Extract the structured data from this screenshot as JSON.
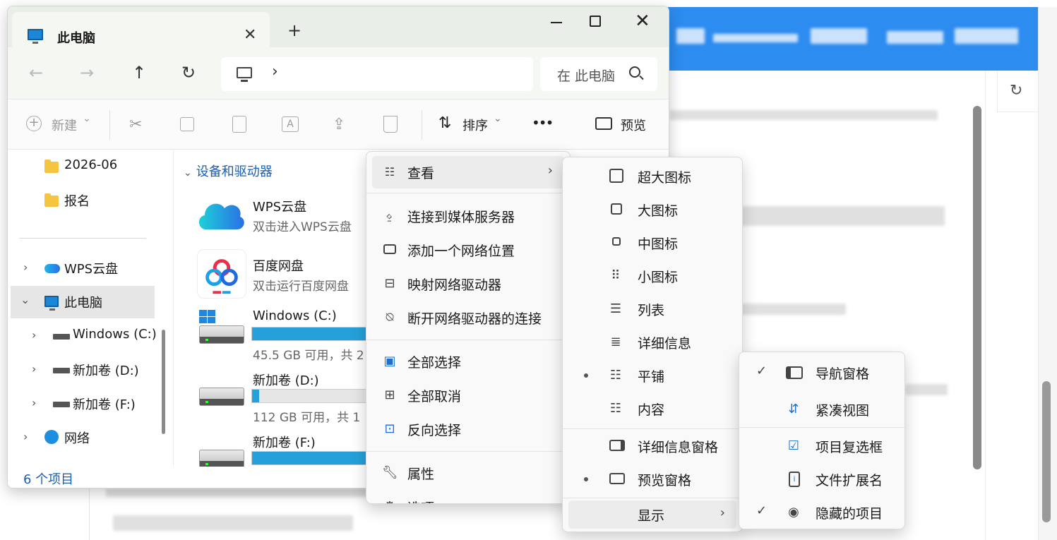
{
  "explorer": {
    "tab_title": "此电脑",
    "close_glyph": "✕",
    "new_tab_glyph": "+",
    "window_close_glyph": "✕",
    "back_glyph": "←",
    "forward_glyph": "→",
    "up_glyph": "↑",
    "refresh_glyph": "↻",
    "address_chevron": "›",
    "search_placeholder": "在 此电脑",
    "toolbar": {
      "new_label": "新建",
      "new_caret": "⌄",
      "sort_label": "排序",
      "sort_caret": "⌄",
      "more_label": "•••",
      "preview_label": "预览"
    },
    "nav": [
      {
        "label": "2026-06"
      },
      {
        "label": "报名"
      },
      {
        "label": "WPS云盘"
      },
      {
        "label": "此电脑"
      },
      {
        "label": "Windows (C:)"
      },
      {
        "label": "新加卷 (D:)"
      },
      {
        "label": "新加卷 (F:)"
      },
      {
        "label": "网络"
      }
    ],
    "group_header": "设备和驱动器",
    "items": [
      {
        "name": "WPS云盘",
        "sub": "双击进入WPS云盘"
      },
      {
        "name": "百度网盘",
        "sub": "双击运行百度网盘"
      },
      {
        "name": "Windows (C:)",
        "sub": "45.5 GB 可用，共 2",
        "fill": 0.85
      },
      {
        "name": "新加卷 (D:)",
        "sub": "112 GB 可用，共 1",
        "fill": 0.05
      },
      {
        "name": "新加卷 (F:)",
        "sub": "",
        "fill": 0.9
      }
    ],
    "status": "6 个项目"
  },
  "more_menu": {
    "items": [
      {
        "label": "查看",
        "arrow": "›"
      },
      {
        "label": "连接到媒体服务器"
      },
      {
        "label": "添加一个网络位置"
      },
      {
        "label": "映射网络驱动器"
      },
      {
        "label": "断开网络驱动器的连接"
      },
      {
        "label": "全部选择"
      },
      {
        "label": "全部取消"
      },
      {
        "label": "反向选择"
      },
      {
        "label": "属性"
      },
      {
        "label": "选项"
      }
    ]
  },
  "view_menu": {
    "items": [
      {
        "label": "超大图标"
      },
      {
        "label": "大图标"
      },
      {
        "label": "中图标"
      },
      {
        "label": "小图标"
      },
      {
        "label": "列表"
      },
      {
        "label": "详细信息"
      },
      {
        "label": "平铺",
        "selected": true
      },
      {
        "label": "内容"
      },
      {
        "label": "详细信息窗格"
      },
      {
        "label": "预览窗格",
        "selected": true
      },
      {
        "label": "显示",
        "arrow": "›"
      }
    ]
  },
  "show_menu": {
    "items": [
      {
        "label": "导航窗格",
        "checked": "✓"
      },
      {
        "label": "紧凑视图"
      },
      {
        "label": "项目复选框"
      },
      {
        "label": "文件扩展名"
      },
      {
        "label": "隐藏的项目",
        "checked": "✓"
      }
    ]
  },
  "background": {
    "refresh_glyph": "↻",
    "accent_color": "#2d8cf0"
  }
}
